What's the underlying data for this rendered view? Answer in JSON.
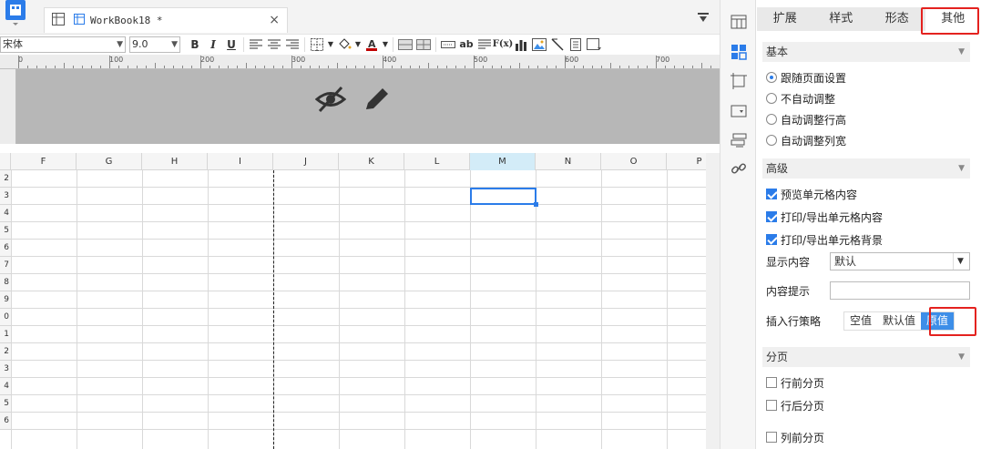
{
  "document": {
    "tab_label": "WorkBook18 *",
    "close": "×"
  },
  "toolbar": {
    "font_family": "宋体",
    "font_size": "9.0",
    "bold": "B",
    "italic": "I",
    "underline": "U",
    "text_tool": "ab",
    "formula": "F(x)"
  },
  "ruler": {
    "ticks": [
      "0",
      "100",
      "200",
      "300",
      "400",
      "500",
      "600",
      "700"
    ]
  },
  "grid": {
    "columns": [
      "F",
      "G",
      "H",
      "I",
      "J",
      "K",
      "L",
      "M",
      "N",
      "O",
      "P"
    ],
    "active_column": "M",
    "rows": [
      "2",
      "3",
      "4",
      "5",
      "6",
      "7",
      "8",
      "9",
      "0",
      "1",
      "2",
      "3",
      "4",
      "5",
      "6"
    ]
  },
  "panel": {
    "tabs": [
      "扩展",
      "样式",
      "形态",
      "其他"
    ],
    "active_tab": "其他",
    "basic": {
      "title": "基本",
      "options": [
        "跟随页面设置",
        "不自动调整",
        "自动调整行高",
        "自动调整列宽"
      ],
      "selected_index": 0
    },
    "advanced": {
      "title": "高级",
      "checks": [
        {
          "label": "预览单元格内容",
          "checked": true
        },
        {
          "label": "打印/导出单元格内容",
          "checked": true
        },
        {
          "label": "打印/导出单元格背景",
          "checked": true
        }
      ],
      "display_label": "显示内容",
      "display_value": "默认",
      "hint_label": "内容提示",
      "insert_label": "插入行策略",
      "insert_options": [
        "空值",
        "默认值",
        "原值"
      ],
      "insert_active": "原值"
    },
    "paging": {
      "title": "分页",
      "checks": [
        {
          "label": "行前分页",
          "checked": false
        },
        {
          "label": "行后分页",
          "checked": false
        },
        {
          "label": "列前分页",
          "checked": false
        }
      ]
    }
  }
}
